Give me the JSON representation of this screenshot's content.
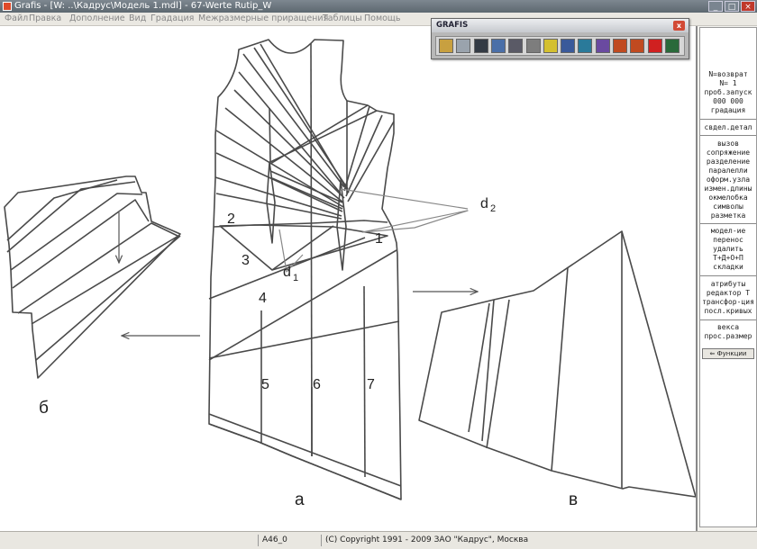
{
  "window": {
    "title": "Grafis - [W: ..\\Кадрус\\Модель 1.mdl] - 67-Werte Rutip_W"
  },
  "window_controls": {
    "minimize": "_",
    "maximize": "□",
    "close": "×"
  },
  "menu": [
    "Файл",
    "Правка",
    "Дополнение",
    "Вид",
    "Градация",
    "Межразмерные приращения",
    "Таблицы",
    "Помощь"
  ],
  "toolbar": {
    "title": "GRAFIS",
    "close": "x",
    "buttons": [
      {
        "icon": "open-folder-icon",
        "color": "#c8a040"
      },
      {
        "icon": "open-file-icon",
        "color": "#9aa3ad"
      },
      {
        "icon": "save-disk-icon",
        "color": "#333a44"
      },
      {
        "icon": "magnifier-icon",
        "color": "#4a6fa8"
      },
      {
        "icon": "print-icon",
        "color": "#5a5a66"
      },
      {
        "icon": "table-icon",
        "color": "#7d7d7d"
      },
      {
        "icon": "ruler-icon",
        "color": "#d4c030"
      },
      {
        "icon": "globe-icon",
        "color": "#3a5a9a"
      },
      {
        "icon": "wand-icon",
        "color": "#2a7a9a"
      },
      {
        "icon": "pattern-icon",
        "color": "#6a4aa0"
      },
      {
        "icon": "import-icon",
        "color": "#c04a20"
      },
      {
        "icon": "export-icon",
        "color": "#c04a20"
      },
      {
        "icon": "stop-icon",
        "color": "#d02020"
      },
      {
        "icon": "screen-icon",
        "color": "#2a6a3a"
      }
    ]
  },
  "right_panel": {
    "header": [
      "N=возврат",
      "N= 1",
      "проб.запуск",
      "000 000",
      "градация"
    ],
    "group1": [
      "свдел.детал"
    ],
    "group2": [
      "вызов",
      "сопряжение",
      "разделение",
      "паралелли",
      "оформ.узла",
      "измен.длины",
      "окмелобка",
      "символы",
      "разметка"
    ],
    "group3": [
      "модел-ие",
      "перенос",
      "удалить",
      "Т+Д+О+П",
      "складки"
    ],
    "group4": [
      "атрибуты",
      "редактор Т",
      "трансфор-ция",
      "посл.кривых"
    ],
    "group5": [
      "векса",
      "прос.размер"
    ],
    "button": "⇐ Функции"
  },
  "drawing": {
    "labels": {
      "a": "а",
      "b": "б",
      "v": "в",
      "n1": "1",
      "n2": "2",
      "n3": "3",
      "n4": "4",
      "n5": "5",
      "n6": "6",
      "n7": "7",
      "d1": "d",
      "d1_sub": "1",
      "d2": "d",
      "d2_sub": "2"
    }
  },
  "status": {
    "cell1": "A46_0",
    "copyright": "(C) Copyright 1991 - 2009 ЗАО \"Кадрус\", Москва"
  }
}
